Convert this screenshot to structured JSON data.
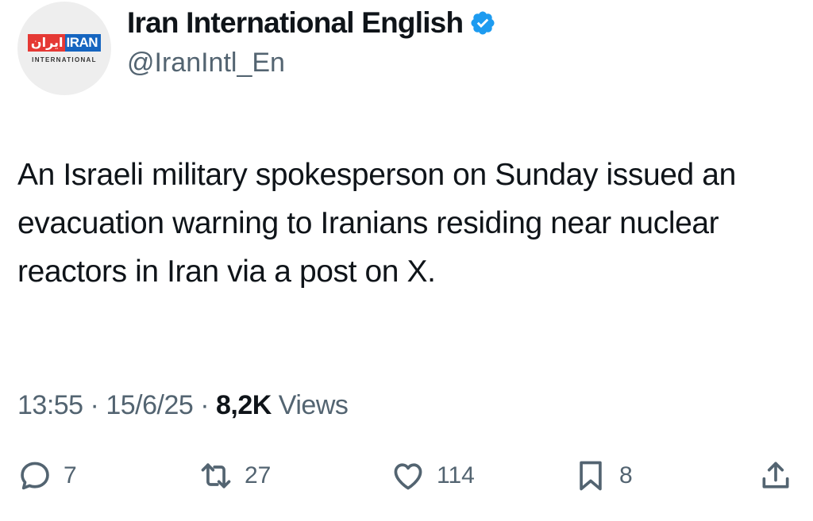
{
  "account": {
    "display_name": "Iran International English",
    "handle": "@IranIntl_En",
    "verified": true,
    "verified_color": "#1d9bf0",
    "avatar": {
      "logo_fa": "ایران",
      "logo_en": "IRAN",
      "logo_sub": "INTERNATIONAL"
    }
  },
  "tweet": {
    "text": "An Israeli military spokesperson on Sunday issued an evacuation warning to Iranians residing near nuclear reactors in Iran via a post on X.",
    "time": "13:55",
    "sep1": "·",
    "date": "15/6/25",
    "sep2": "·",
    "views_count": "8,2K",
    "views_label": "Views"
  },
  "actions": {
    "replies": "7",
    "reposts": "27",
    "likes": "114",
    "bookmarks": "8"
  }
}
